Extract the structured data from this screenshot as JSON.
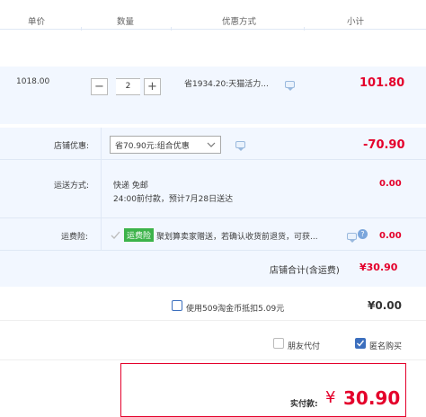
{
  "header": {
    "col_price": "单价",
    "col_qty": "数量",
    "col_promo": "优惠方式",
    "col_subtotal": "小计"
  },
  "item": {
    "unit_price": "1018.00",
    "quantity": "2",
    "promo_text": "省1934.20:天猫活力...",
    "subtotal": "101.80"
  },
  "shop_discount": {
    "label": "店铺优惠:",
    "select_value": "省70.90元:组合优惠",
    "amount": "-70.90"
  },
  "shipping": {
    "label": "运送方式:",
    "method": "快递 免邮",
    "eta": "24:00前付款，预计7月28日送达",
    "amount": "0.00"
  },
  "insurance": {
    "label": "运费险:",
    "badge": "运费险",
    "desc": "聚划算卖家赠送，若确认收货前退货，可获...",
    "amount": "0.00",
    "checked": true
  },
  "shop_total": {
    "label": "店铺合计(含运费)",
    "amount": "¥30.90"
  },
  "taojinbi": {
    "label": "使用509淘金币抵扣5.09元",
    "amount": "¥0.00",
    "checked": false
  },
  "options": {
    "friend_pay": "朋友代付",
    "friend_pay_checked": false,
    "anonymous": "匿名购买",
    "anonymous_checked": true
  },
  "payment": {
    "label": "实付款:",
    "currency": "¥",
    "amount": "30.90"
  },
  "colors": {
    "price_red": "#e4002b",
    "panel_blue": "#f2f7ff",
    "link_blue": "#3c6fbe",
    "badge_green": "#3cb34a"
  }
}
